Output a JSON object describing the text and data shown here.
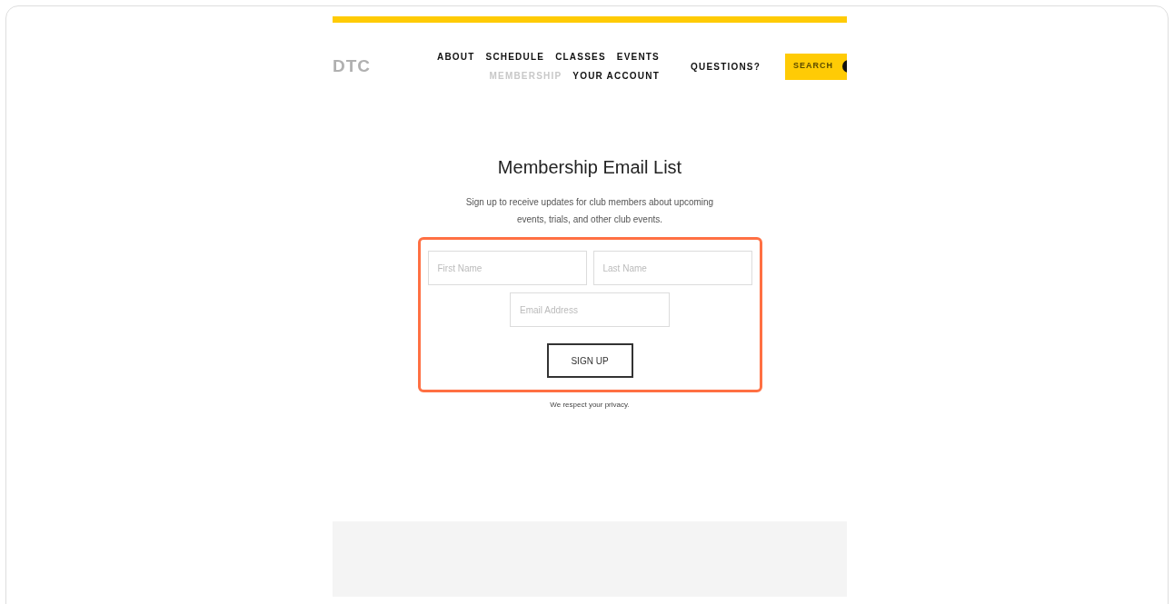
{
  "header": {
    "logo": "DTC",
    "nav_rows": [
      [
        {
          "label": "ABOUT",
          "selected": false
        },
        {
          "label": "SCHEDULE",
          "selected": false
        },
        {
          "label": "CLASSES",
          "selected": false
        },
        {
          "label": "EVENTS",
          "selected": false
        }
      ],
      [
        {
          "label": "MEMBERSHIP",
          "selected": true
        },
        {
          "label": "YOUR ACCOUNT",
          "selected": false
        }
      ]
    ],
    "questions": "QUESTIONS?",
    "search_button": "SEARCH"
  },
  "signup": {
    "title": "Membership Email List",
    "description": "Sign up to receive updates for club members about upcoming events, trials, and other club events.",
    "first_name": {
      "placeholder": "First Name"
    },
    "last_name": {
      "placeholder": "Last Name"
    },
    "email": {
      "placeholder": "Email Address"
    },
    "button": "SIGN UP",
    "privacy": "We respect your privacy."
  }
}
